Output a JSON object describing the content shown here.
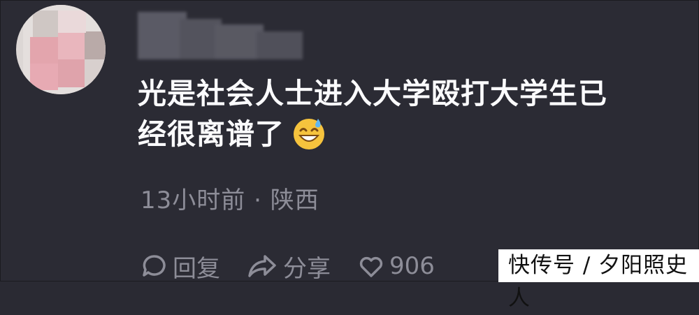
{
  "comment": {
    "line1": "光是社会人士进入大学殴打大学生已",
    "line2": "经很离谱了",
    "emoji": "sweat-smile-emoji"
  },
  "meta": {
    "time": "13小时前",
    "separator": "·",
    "location": "陕西"
  },
  "actions": {
    "reply_label": "回复",
    "share_label": "分享",
    "like_count": "906"
  },
  "watermark": {
    "text": "快传号 / 夕阳照史人"
  },
  "colors": {
    "background": "#2b2b34",
    "text": "#fbfbfd",
    "meta": "#8d8d98"
  }
}
